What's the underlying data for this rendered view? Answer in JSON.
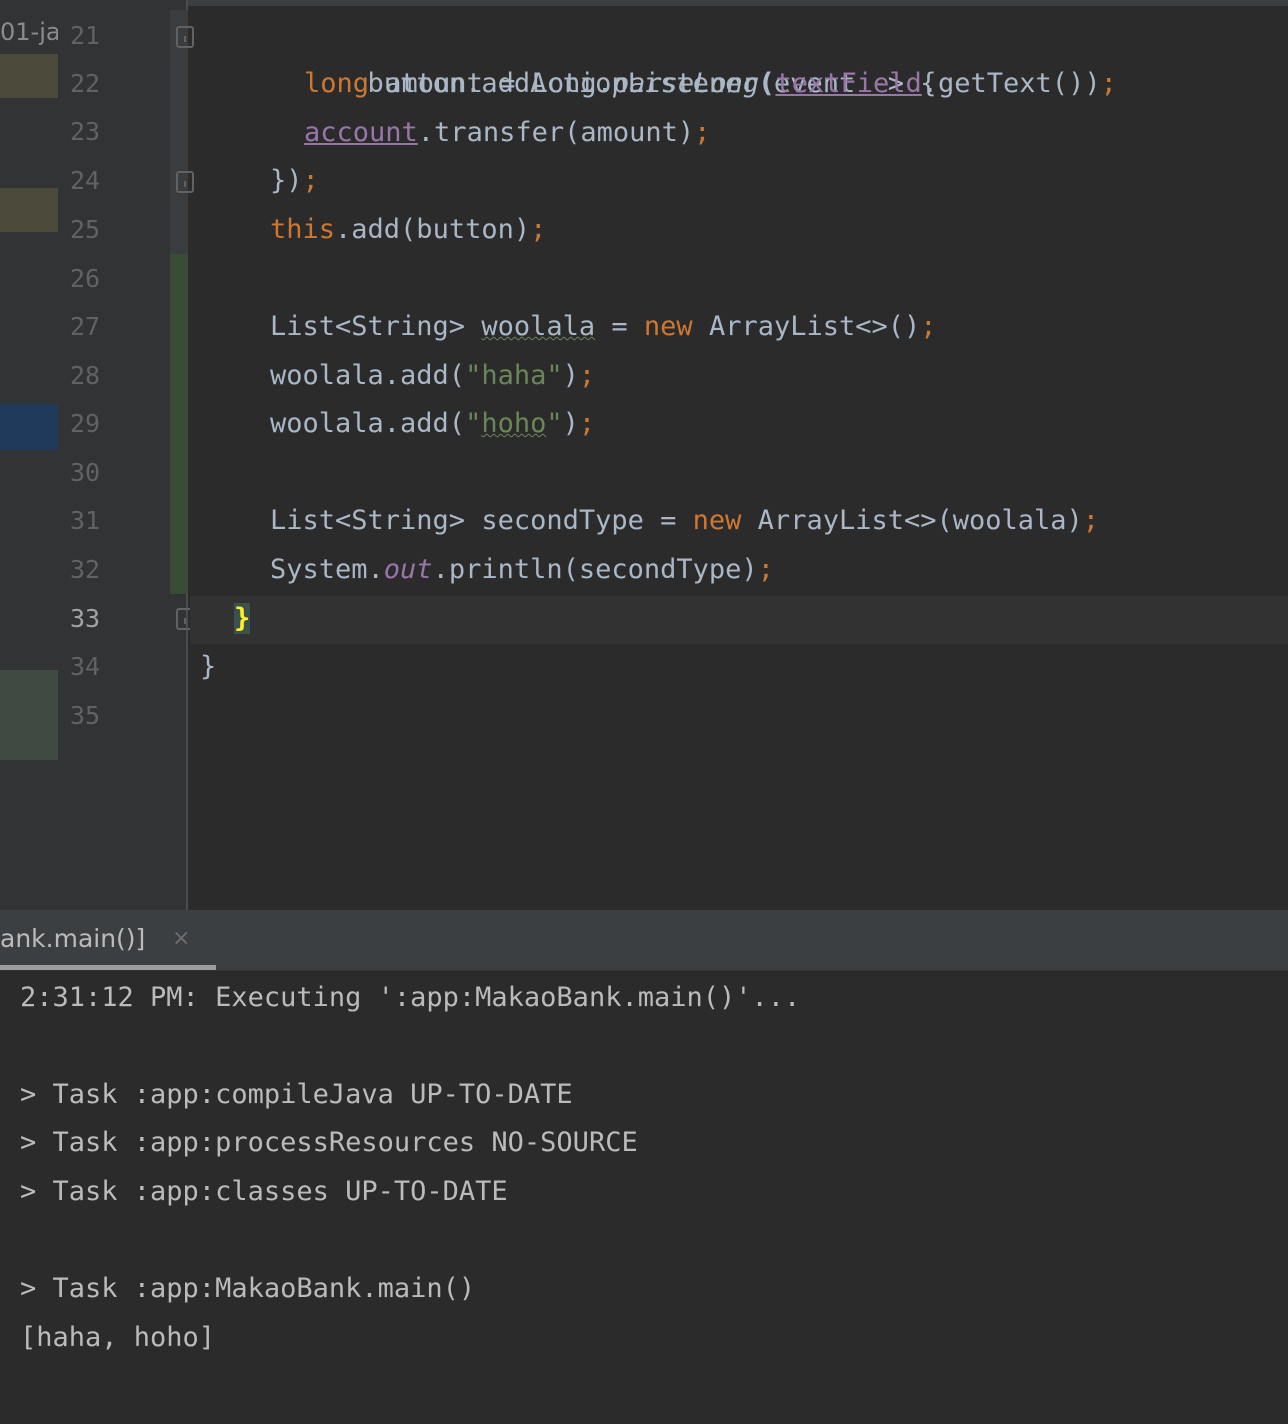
{
  "editor": {
    "file_tab_fragment": "01-ja",
    "current_line": "33",
    "line_numbers": [
      "21",
      "22",
      "23",
      "24",
      "25",
      "26",
      "27",
      "28",
      "29",
      "30",
      "31",
      "32",
      "33",
      "34",
      "35"
    ],
    "lines": {
      "l21": {
        "a": "button.addActionListener(event -> {"
      },
      "l22": {
        "kw": "long",
        "a": " amount = Long.",
        "m": "parseLong",
        "b": "(",
        "f": "textField",
        "c": ".getText())",
        "s": ";"
      },
      "l23": {
        "f": "account",
        "a": ".transfer(amount)",
        "s": ";"
      },
      "l24": {
        "a": "})",
        "s": ";"
      },
      "l25": {
        "kw": "this",
        "a": ".add(button)",
        "s": ";"
      },
      "l27": {
        "a": "List<String> ",
        "w": "woolala",
        "b": " = ",
        "kw": "new",
        "c": " ArrayList<>()",
        "s": ";"
      },
      "l28": {
        "a": "woolala.add(",
        "str": "\"haha\"",
        "b": ")",
        "s": ";"
      },
      "l29": {
        "a": "woolala.add(",
        "q1": "\"",
        "str": "hoho",
        "q2": "\"",
        "b": ")",
        "s": ";"
      },
      "l31": {
        "a": "List<String> secondType = ",
        "kw": "new",
        "b": " ArrayList<>(woolala)",
        "s": ";"
      },
      "l32": {
        "a": "System.",
        "f": "out",
        "b": ".println(secondType)",
        "s": ";"
      },
      "l33": {
        "a": "}"
      },
      "l34": {
        "a": "}"
      }
    }
  },
  "run_panel": {
    "tab_label": "ank.main()]",
    "close_glyph": "×",
    "output": [
      "2:31:12 PM: Executing ':app:MakaoBank.main()'...",
      "",
      "> Task :app:compileJava UP-TO-DATE",
      "> Task :app:processResources NO-SOURCE",
      "> Task :app:classes UP-TO-DATE",
      "",
      "> Task :app:MakaoBank.main()",
      "[haha, hoho]"
    ]
  },
  "colors": {
    "background": "#2b2b2b",
    "keyword": "#cc7832",
    "string": "#6a8759",
    "field": "#9876aa",
    "text": "#a9b7c6",
    "brace_highlight": "#ffef28"
  }
}
